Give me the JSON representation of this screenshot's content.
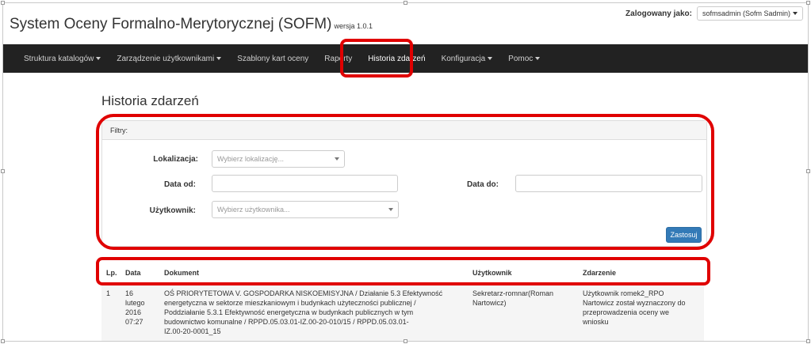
{
  "header": {
    "title": "System Oceny Formalno-Merytorycznej (SOFM)",
    "version": "wersja 1.0.1",
    "login_label": "Zalogowany jako:",
    "login_user": "sofmsadmin (Sofm Sadmin)"
  },
  "nav": {
    "items": [
      {
        "label": "Struktura katalogów",
        "dropdown": true
      },
      {
        "label": "Zarządzenie użytkownikami",
        "dropdown": true
      },
      {
        "label": "Szablony kart oceny",
        "dropdown": false
      },
      {
        "label": "Raporty",
        "dropdown": false
      },
      {
        "label": "Historia zdarzeń",
        "dropdown": false,
        "active": true
      },
      {
        "label": "Konfiguracja",
        "dropdown": true
      },
      {
        "label": "Pomoc",
        "dropdown": true
      }
    ]
  },
  "page": {
    "title": "Historia zdarzeń"
  },
  "filters": {
    "heading": "Filtry:",
    "location_label": "Lokalizacja:",
    "location_placeholder": "Wybierz lokalizację...",
    "date_from_label": "Data od:",
    "date_from_value": "",
    "date_to_label": "Data do:",
    "date_to_value": "",
    "user_label": "Użytkownik:",
    "user_placeholder": "Wybierz użytkownika...",
    "apply_label": "Zastosuj"
  },
  "table": {
    "columns": [
      "Lp.",
      "Data",
      "Dokument",
      "Użytkownik",
      "Zdarzenie"
    ],
    "rows": [
      {
        "lp": "1",
        "date": [
          "16",
          "lutego",
          "2016",
          "07:27"
        ],
        "document": [
          "OŚ PRIORYTETOWA V. GOSPODARKA NISKOEMISYJNA / Działanie 5.3 Efektywność",
          "energetyczna w sektorze mieszkaniowym i budynkach użyteczności publicznej /",
          "Poddziałanie 5.3.1 Efektywność energetyczna w budynkach publicznych w tym",
          "budownictwo komunalne / RPPD.05.03.01-IZ.00-20-010/15 / RPPD.05.03.01-",
          "IZ.00-20-0001_15"
        ],
        "user": [
          "Sekretarz-romnar(Roman",
          "Nartowicz)"
        ],
        "event": [
          "Użytkownik romek2_RPO",
          "Nartowicz został wyznaczony do",
          "przeprowadzenia oceny we",
          "wniosku"
        ]
      }
    ]
  },
  "colors": {
    "navbar_bg": "#222222",
    "highlight": "#e00000",
    "primary_button": "#337ab7"
  }
}
